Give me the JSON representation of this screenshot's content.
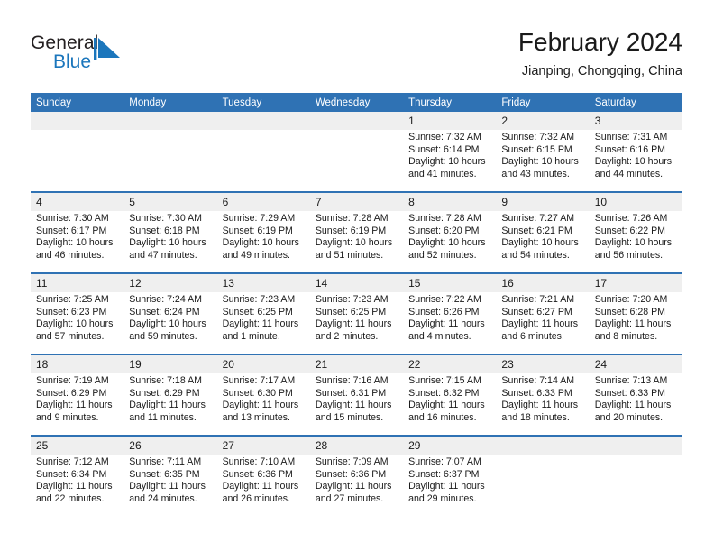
{
  "brand": {
    "name_top": "General",
    "name_bottom": "Blue",
    "mark": "triangle-logo",
    "color_primary": "#1b76bc",
    "color_text": "#231f20"
  },
  "header": {
    "title": "February 2024",
    "subtitle": "Jianping, Chongqing, China"
  },
  "calendar": {
    "header_bg": "#2f72b4",
    "daynum_bg": "#efefef",
    "rule_color": "#2f72b4",
    "weekdays": [
      "Sunday",
      "Monday",
      "Tuesday",
      "Wednesday",
      "Thursday",
      "Friday",
      "Saturday"
    ],
    "weeks": [
      [
        {
          "day": "",
          "sunrise": "",
          "sunset": "",
          "daylight1": "",
          "daylight2": ""
        },
        {
          "day": "",
          "sunrise": "",
          "sunset": "",
          "daylight1": "",
          "daylight2": ""
        },
        {
          "day": "",
          "sunrise": "",
          "sunset": "",
          "daylight1": "",
          "daylight2": ""
        },
        {
          "day": "",
          "sunrise": "",
          "sunset": "",
          "daylight1": "",
          "daylight2": ""
        },
        {
          "day": "1",
          "sunrise": "Sunrise: 7:32 AM",
          "sunset": "Sunset: 6:14 PM",
          "daylight1": "Daylight: 10 hours",
          "daylight2": "and 41 minutes."
        },
        {
          "day": "2",
          "sunrise": "Sunrise: 7:32 AM",
          "sunset": "Sunset: 6:15 PM",
          "daylight1": "Daylight: 10 hours",
          "daylight2": "and 43 minutes."
        },
        {
          "day": "3",
          "sunrise": "Sunrise: 7:31 AM",
          "sunset": "Sunset: 6:16 PM",
          "daylight1": "Daylight: 10 hours",
          "daylight2": "and 44 minutes."
        }
      ],
      [
        {
          "day": "4",
          "sunrise": "Sunrise: 7:30 AM",
          "sunset": "Sunset: 6:17 PM",
          "daylight1": "Daylight: 10 hours",
          "daylight2": "and 46 minutes."
        },
        {
          "day": "5",
          "sunrise": "Sunrise: 7:30 AM",
          "sunset": "Sunset: 6:18 PM",
          "daylight1": "Daylight: 10 hours",
          "daylight2": "and 47 minutes."
        },
        {
          "day": "6",
          "sunrise": "Sunrise: 7:29 AM",
          "sunset": "Sunset: 6:19 PM",
          "daylight1": "Daylight: 10 hours",
          "daylight2": "and 49 minutes."
        },
        {
          "day": "7",
          "sunrise": "Sunrise: 7:28 AM",
          "sunset": "Sunset: 6:19 PM",
          "daylight1": "Daylight: 10 hours",
          "daylight2": "and 51 minutes."
        },
        {
          "day": "8",
          "sunrise": "Sunrise: 7:28 AM",
          "sunset": "Sunset: 6:20 PM",
          "daylight1": "Daylight: 10 hours",
          "daylight2": "and 52 minutes."
        },
        {
          "day": "9",
          "sunrise": "Sunrise: 7:27 AM",
          "sunset": "Sunset: 6:21 PM",
          "daylight1": "Daylight: 10 hours",
          "daylight2": "and 54 minutes."
        },
        {
          "day": "10",
          "sunrise": "Sunrise: 7:26 AM",
          "sunset": "Sunset: 6:22 PM",
          "daylight1": "Daylight: 10 hours",
          "daylight2": "and 56 minutes."
        }
      ],
      [
        {
          "day": "11",
          "sunrise": "Sunrise: 7:25 AM",
          "sunset": "Sunset: 6:23 PM",
          "daylight1": "Daylight: 10 hours",
          "daylight2": "and 57 minutes."
        },
        {
          "day": "12",
          "sunrise": "Sunrise: 7:24 AM",
          "sunset": "Sunset: 6:24 PM",
          "daylight1": "Daylight: 10 hours",
          "daylight2": "and 59 minutes."
        },
        {
          "day": "13",
          "sunrise": "Sunrise: 7:23 AM",
          "sunset": "Sunset: 6:25 PM",
          "daylight1": "Daylight: 11 hours",
          "daylight2": "and 1 minute."
        },
        {
          "day": "14",
          "sunrise": "Sunrise: 7:23 AM",
          "sunset": "Sunset: 6:25 PM",
          "daylight1": "Daylight: 11 hours",
          "daylight2": "and 2 minutes."
        },
        {
          "day": "15",
          "sunrise": "Sunrise: 7:22 AM",
          "sunset": "Sunset: 6:26 PM",
          "daylight1": "Daylight: 11 hours",
          "daylight2": "and 4 minutes."
        },
        {
          "day": "16",
          "sunrise": "Sunrise: 7:21 AM",
          "sunset": "Sunset: 6:27 PM",
          "daylight1": "Daylight: 11 hours",
          "daylight2": "and 6 minutes."
        },
        {
          "day": "17",
          "sunrise": "Sunrise: 7:20 AM",
          "sunset": "Sunset: 6:28 PM",
          "daylight1": "Daylight: 11 hours",
          "daylight2": "and 8 minutes."
        }
      ],
      [
        {
          "day": "18",
          "sunrise": "Sunrise: 7:19 AM",
          "sunset": "Sunset: 6:29 PM",
          "daylight1": "Daylight: 11 hours",
          "daylight2": "and 9 minutes."
        },
        {
          "day": "19",
          "sunrise": "Sunrise: 7:18 AM",
          "sunset": "Sunset: 6:29 PM",
          "daylight1": "Daylight: 11 hours",
          "daylight2": "and 11 minutes."
        },
        {
          "day": "20",
          "sunrise": "Sunrise: 7:17 AM",
          "sunset": "Sunset: 6:30 PM",
          "daylight1": "Daylight: 11 hours",
          "daylight2": "and 13 minutes."
        },
        {
          "day": "21",
          "sunrise": "Sunrise: 7:16 AM",
          "sunset": "Sunset: 6:31 PM",
          "daylight1": "Daylight: 11 hours",
          "daylight2": "and 15 minutes."
        },
        {
          "day": "22",
          "sunrise": "Sunrise: 7:15 AM",
          "sunset": "Sunset: 6:32 PM",
          "daylight1": "Daylight: 11 hours",
          "daylight2": "and 16 minutes."
        },
        {
          "day": "23",
          "sunrise": "Sunrise: 7:14 AM",
          "sunset": "Sunset: 6:33 PM",
          "daylight1": "Daylight: 11 hours",
          "daylight2": "and 18 minutes."
        },
        {
          "day": "24",
          "sunrise": "Sunrise: 7:13 AM",
          "sunset": "Sunset: 6:33 PM",
          "daylight1": "Daylight: 11 hours",
          "daylight2": "and 20 minutes."
        }
      ],
      [
        {
          "day": "25",
          "sunrise": "Sunrise: 7:12 AM",
          "sunset": "Sunset: 6:34 PM",
          "daylight1": "Daylight: 11 hours",
          "daylight2": "and 22 minutes."
        },
        {
          "day": "26",
          "sunrise": "Sunrise: 7:11 AM",
          "sunset": "Sunset: 6:35 PM",
          "daylight1": "Daylight: 11 hours",
          "daylight2": "and 24 minutes."
        },
        {
          "day": "27",
          "sunrise": "Sunrise: 7:10 AM",
          "sunset": "Sunset: 6:36 PM",
          "daylight1": "Daylight: 11 hours",
          "daylight2": "and 26 minutes."
        },
        {
          "day": "28",
          "sunrise": "Sunrise: 7:09 AM",
          "sunset": "Sunset: 6:36 PM",
          "daylight1": "Daylight: 11 hours",
          "daylight2": "and 27 minutes."
        },
        {
          "day": "29",
          "sunrise": "Sunrise: 7:07 AM",
          "sunset": "Sunset: 6:37 PM",
          "daylight1": "Daylight: 11 hours",
          "daylight2": "and 29 minutes."
        },
        {
          "day": "",
          "sunrise": "",
          "sunset": "",
          "daylight1": "",
          "daylight2": ""
        },
        {
          "day": "",
          "sunrise": "",
          "sunset": "",
          "daylight1": "",
          "daylight2": ""
        }
      ]
    ]
  }
}
